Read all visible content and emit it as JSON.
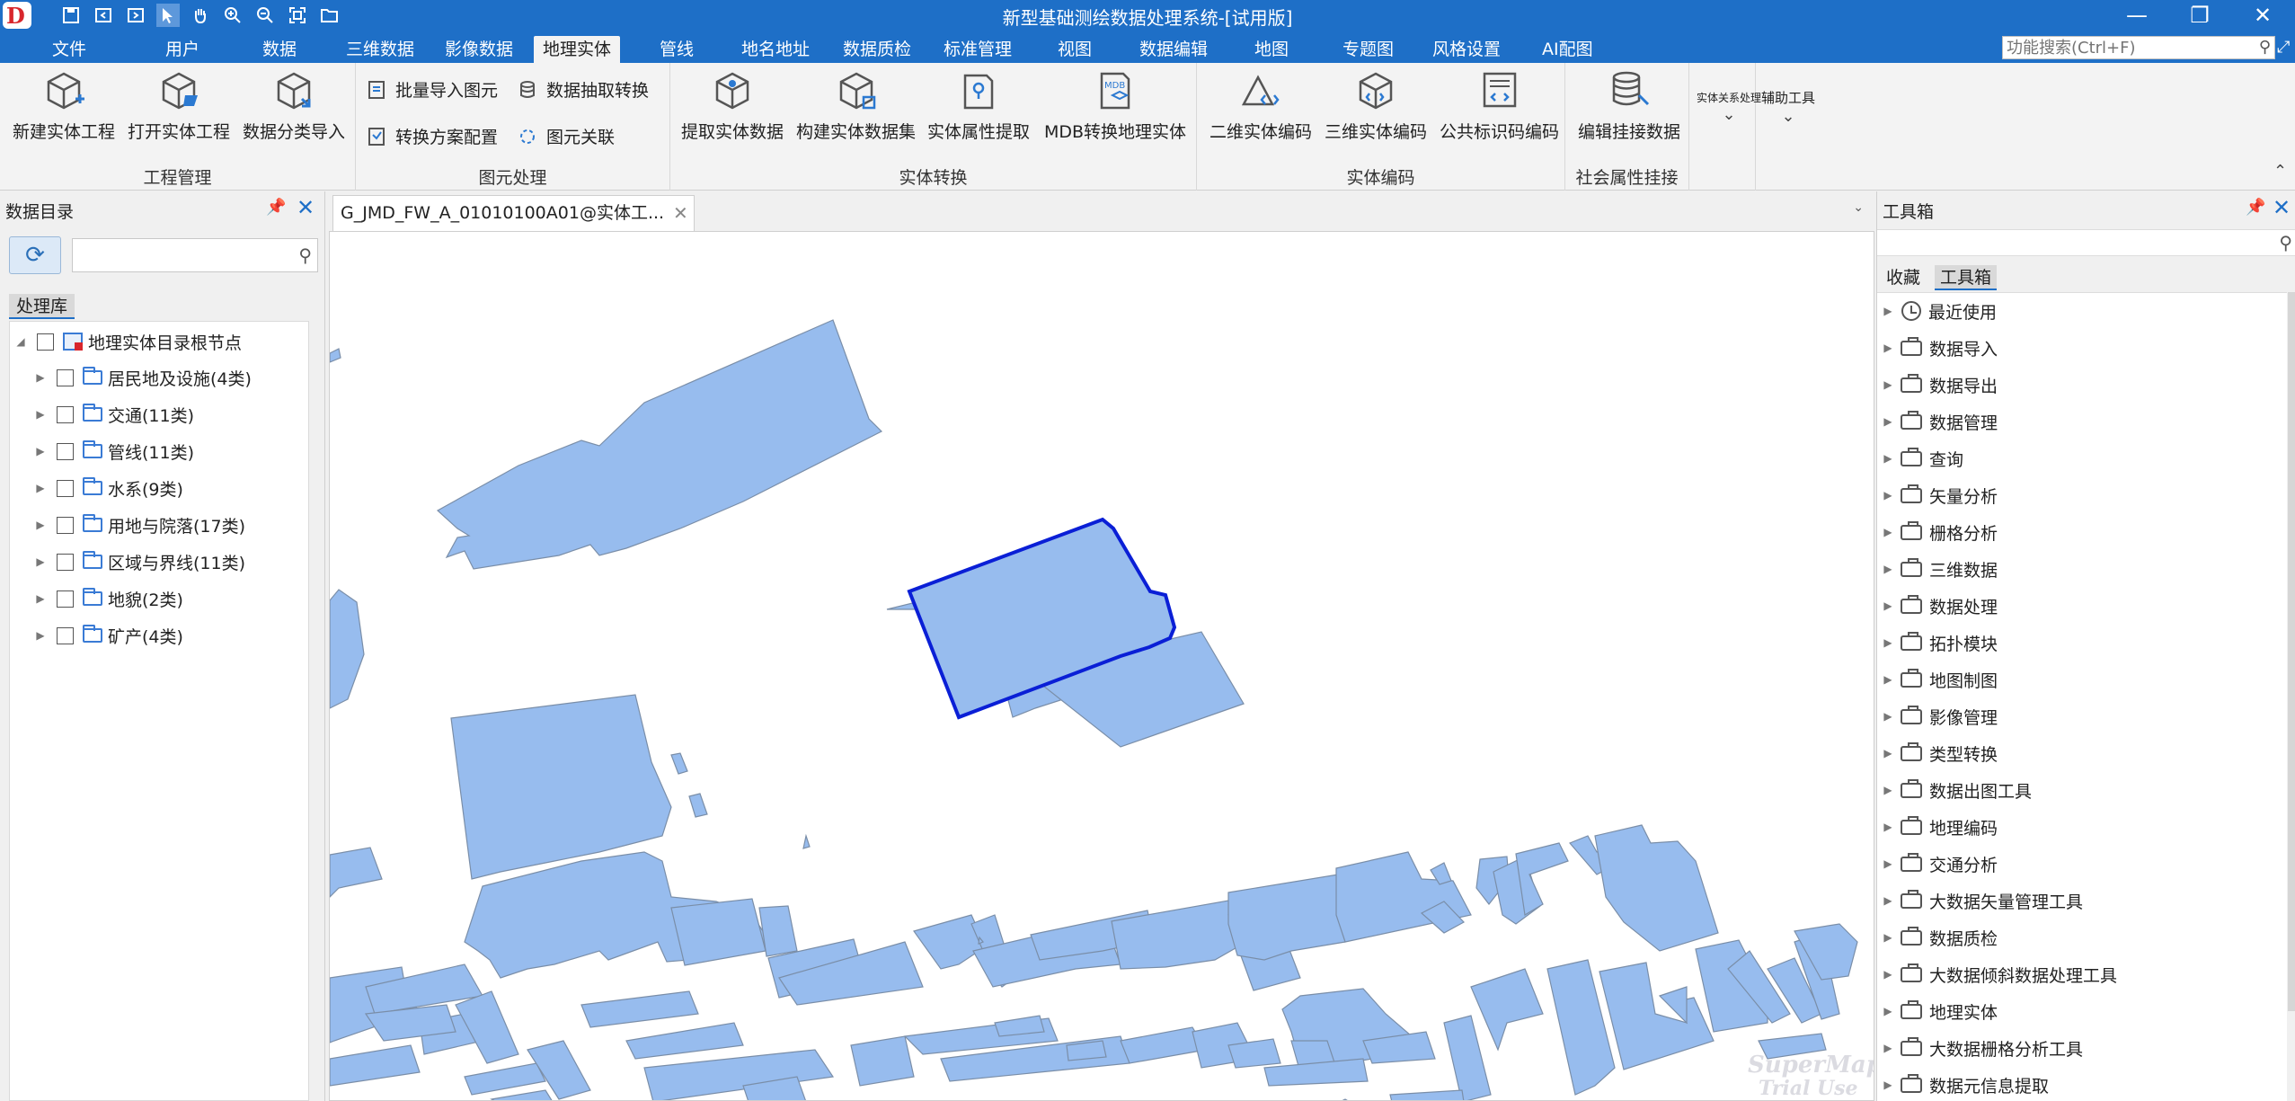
{
  "titlebar": {
    "title": "新型基础测绘数据处理系统-[试用版]",
    "quick_access": [
      "save-icon",
      "window-left-icon",
      "window-right-icon",
      "pointer-icon",
      "pan-hand-icon",
      "zoom-in-icon",
      "zoom-out-icon",
      "full-extent-icon",
      "open-folder-icon"
    ],
    "controls": {
      "minimize": "—",
      "restore": "❐",
      "close": "✕"
    }
  },
  "menu": {
    "tabs": [
      "文件",
      "用户",
      "数据",
      "三维数据",
      "影像数据",
      "地理实体",
      "管线",
      "地名地址",
      "数据质检",
      "标准管理",
      "视图",
      "数据编辑",
      "地图",
      "专题图",
      "风格设置",
      "AI配图"
    ],
    "active_tab": "地理实体",
    "search_placeholder": "功能搜索(Ctrl+F)"
  },
  "ribbon": {
    "groups": {
      "project": "工程管理",
      "element": "图元处理",
      "entity_convert": "实体转换",
      "entity_code": "实体编码",
      "social_attach": "社会属性挂接"
    },
    "buttons": {
      "new_project": "新建实体工程",
      "open_project": "打开实体工程",
      "classify_import": "数据分类导入",
      "batch_import": "批量导入图元",
      "extract_convert": "数据抽取转换",
      "scheme_config": "转换方案配置",
      "element_link": "图元关联",
      "extract_entity": "提取实体数据",
      "build_dataset": "构建实体数据集",
      "attr_extract": "实体属性提取",
      "mdb_convert": "MDB转换地理实体",
      "code_2d": "二维实体编码",
      "code_3d": "三维实体编码",
      "public_code": "公共标识码编码",
      "edit_attach": "编辑挂接数据",
      "relation_proc": "实体关系处理",
      "aux_tools": "辅助工具"
    },
    "mdb_badge": "MDB"
  },
  "left_panel": {
    "title": "数据目录",
    "lib_tab": "处理库",
    "root": "地理实体目录根节点",
    "items": [
      "居民地及设施(4类)",
      "交通(11类)",
      "管线(11类)",
      "水系(9类)",
      "用地与院落(17类)",
      "区域与界线(11类)",
      "地貌(2类)",
      "矿产(4类)"
    ]
  },
  "document": {
    "tab_title": "G_JMD_FW_A_01010100A01@实体工..."
  },
  "watermark": {
    "line1": "SuperMap",
    "line2": "Trial Use"
  },
  "right_panel": {
    "title": "工具箱",
    "tabs": [
      "收藏",
      "工具箱"
    ],
    "active_tab": "工具箱",
    "items": [
      "最近使用",
      "数据导入",
      "数据导出",
      "数据管理",
      "查询",
      "矢量分析",
      "栅格分析",
      "三维数据",
      "数据处理",
      "拓扑模块",
      "地图制图",
      "影像管理",
      "类型转换",
      "数据出图工具",
      "地理编码",
      "交通分析",
      "大数据矢量管理工具",
      "数据质检",
      "大数据倾斜数据处理工具",
      "地理实体",
      "大数据栅格分析工具",
      "数据元信息提取"
    ]
  },
  "colors": {
    "brand": "#1e6fc7",
    "polygon_fill": "#97bcee",
    "polygon_stroke": "#7a8ea8",
    "selected_stroke": "#0a1fd6"
  }
}
